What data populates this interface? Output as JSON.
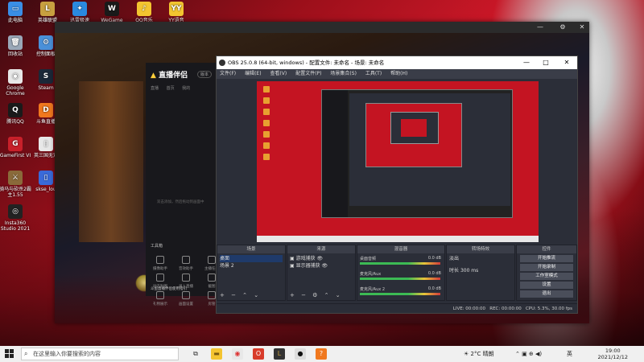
{
  "desktop": {
    "icons": [
      {
        "label": "此电脑",
        "color": "#3a8ee6",
        "glyph": "▭"
      },
      {
        "label": "英雄联盟",
        "color": "#c8a040",
        "glyph": "L"
      },
      {
        "label": "迅雷极速",
        "color": "#2a8ae0",
        "glyph": "✦"
      },
      {
        "label": "WeGame",
        "color": "#1a1a1a",
        "glyph": "W"
      },
      {
        "label": "QQ音乐",
        "color": "#f3c530",
        "glyph": "♪"
      },
      {
        "label": "YY语音",
        "color": "#f3c530",
        "glyph": "YY"
      },
      {
        "label": "回收站",
        "color": "#9aa8b8",
        "glyph": "🗑"
      },
      {
        "label": "控制面板",
        "color": "#4a90d9",
        "glyph": "⚙"
      },
      {
        "label": "Google Chrome",
        "color": "#e8e8e8",
        "glyph": "◉"
      },
      {
        "label": "Steam",
        "color": "#1b2838",
        "glyph": "S"
      },
      {
        "label": "腾讯QQ",
        "color": "#1a1a1a",
        "glyph": "Q"
      },
      {
        "label": "斗鱼直播",
        "color": "#f0781e",
        "glyph": "D"
      },
      {
        "label": "GameFirst VI",
        "color": "#c8202a",
        "glyph": "G"
      },
      {
        "label": "英三国无双",
        "color": "#e8e8e8",
        "glyph": "▯"
      },
      {
        "label": "骑马与砍杀2霸主1.55",
        "color": "#8a6a3a",
        "glyph": "⚔"
      },
      {
        "label": "skse_lou",
        "color": "#3a6ad9",
        "glyph": "▯"
      },
      {
        "label": "Insta360 Studio 2021",
        "color": "#222",
        "glyph": "◎"
      }
    ]
  },
  "game_window": {
    "controls": [
      "—",
      "⚙",
      "✕"
    ]
  },
  "helper": {
    "logo_text": "直播伴侣",
    "badge": "版本",
    "tabs": [
      "直播",
      "首页",
      "我的"
    ],
    "hint": "双击添加，然后拖动到画面中",
    "section_title": "工具箱",
    "tools": [
      "摄像助手",
      "音效助手",
      "主播任务",
      "动态贴图",
      "录入直播",
      "截图",
      "礼物展示",
      "画面设置",
      "房管",
      "一键开播"
    ],
    "bottom_text": "斗鱼直播伴侣使用指引"
  },
  "obs": {
    "title": "OBS 25.0.8 (64-bit, windows) - 配置文件: 未命名 - 场景: 未命名",
    "window_controls": [
      "—",
      "□",
      "✕"
    ],
    "menu": [
      "文件(F)",
      "编辑(E)",
      "查看(V)",
      "配置文件(P)",
      "场景集合(S)",
      "工具(T)",
      "帮助(H)"
    ],
    "docks": {
      "scenes": {
        "title": "场景",
        "items": [
          "桌面",
          "场景 2"
        ]
      },
      "sources": {
        "title": "来源",
        "items": [
          "游戏捕获",
          "显示器捕获"
        ]
      },
      "mixer": {
        "title": "混音器",
        "tracks": [
          {
            "name": "桌面音频",
            "db": "0.0 dB"
          },
          {
            "name": "麦克风/Aux",
            "db": "0.0 dB"
          },
          {
            "name": "麦克风/Aux 2",
            "db": "0.0 dB"
          }
        ]
      },
      "transitions": {
        "title": "转场特效",
        "type": "淡出",
        "duration_label": "时长",
        "duration": "300 ms"
      },
      "controls": {
        "title": "控件",
        "buttons": [
          "开始推流",
          "开始录制",
          "工作室模式",
          "设置",
          "退出"
        ]
      }
    },
    "status": {
      "live": "LIVE: 00:00:00",
      "rec": "REC: 00:00:00",
      "cpu": "CPU: 5.3%, 30.00 fps"
    }
  },
  "taskbar": {
    "search_placeholder": "在这里输入你要搜索的内容",
    "weather": "2°C 晴朗",
    "ime": "英",
    "time": "19:00",
    "date": "2021/12/12"
  }
}
